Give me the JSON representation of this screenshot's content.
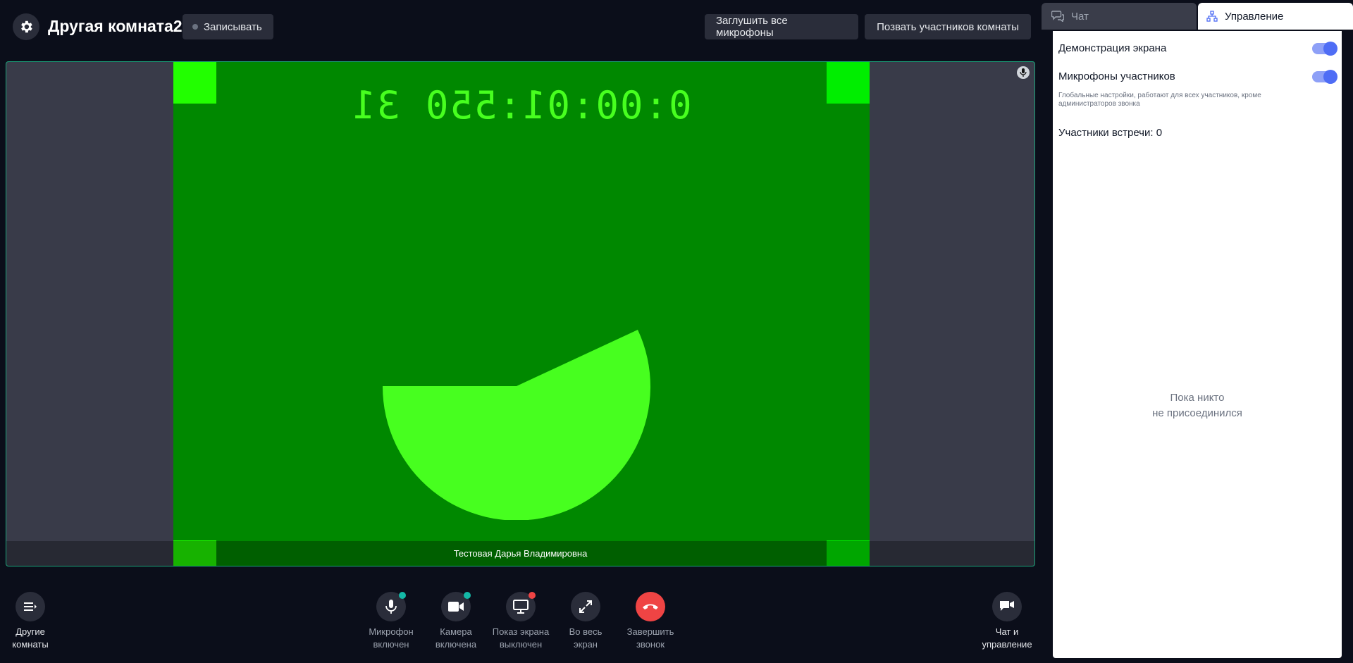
{
  "header": {
    "room_title": "Другая комната2",
    "record_label": "Записывать",
    "mute_all_label": "Заглушить все микрофоны",
    "invite_label": "Позвать участников комнаты"
  },
  "video": {
    "participant_name": "Тестовая Дарья Владимировна",
    "timer_text": "0:00:01:550 31"
  },
  "controls": {
    "other_rooms": "Другие\nкомнаты",
    "mic": "Микрофон\nвключен",
    "camera": "Камера\nвключена",
    "screen": "Показ экрана\nвыключен",
    "fullscreen": "Во весь\nэкран",
    "hangup": "Завершить\nзвонок",
    "chat_manage": "Чат и\nуправление"
  },
  "panel": {
    "tab_chat": "Чат",
    "tab_manage": "Управление",
    "screen_share_label": "Демонстрация экрана",
    "mics_label": "Микрофоны участников",
    "hint": "Глобальные настройки, работают для всех участников, кроме администраторов звонка",
    "participants_label": "Участники встречи: 0",
    "empty_text": "Пока никто\nне присоединился"
  },
  "colors": {
    "accent": "#4f6df5",
    "status_on": "#14b8a6",
    "status_off": "#ef4444",
    "hangup": "#ef4444",
    "video_green": "#008800",
    "bright_green": "#47ff1f"
  }
}
